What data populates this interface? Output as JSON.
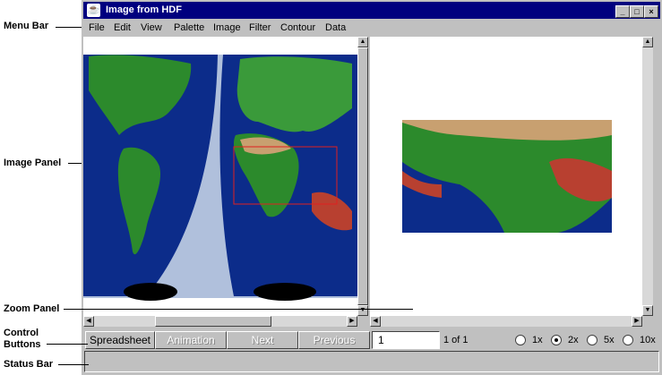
{
  "callouts": {
    "menu_bar": "Menu Bar",
    "image_panel": "Image Panel",
    "zoom_panel": "Zoom Panel",
    "control_buttons_line1": "Control",
    "control_buttons_line2": "Buttons",
    "status_bar": "Status Bar"
  },
  "window": {
    "title": "Image from HDF",
    "title_buttons": [
      "_",
      "□",
      "×"
    ]
  },
  "menu": [
    "File",
    "Edit",
    "View",
    "Palette",
    "Image",
    "Filter",
    "Contour",
    "Data"
  ],
  "controls": {
    "spreadsheet": "Spreadsheet",
    "animation": "Animation",
    "next": "Next",
    "previous": "Previous",
    "page_value": "1",
    "page_count": "1 of 1"
  },
  "zoom_options": [
    {
      "label": "1x",
      "selected": false
    },
    {
      "label": "2x",
      "selected": true
    },
    {
      "label": "5x",
      "selected": false
    },
    {
      "label": "10x",
      "selected": false
    }
  ],
  "status": ""
}
